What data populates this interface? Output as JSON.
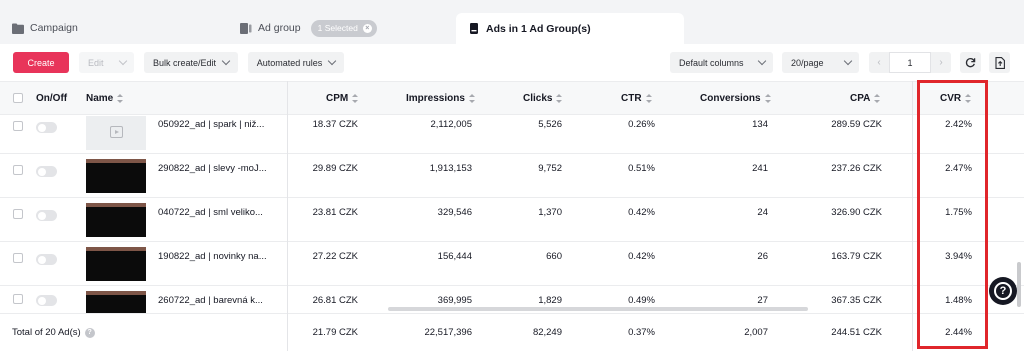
{
  "tabs": {
    "campaign": "Campaign",
    "ad_group": "Ad group",
    "selected_pill": "1 Selected",
    "ads": "Ads in 1 Ad Group(s)"
  },
  "toolbar": {
    "create": "Create",
    "edit": "Edit",
    "bulk": "Bulk create/Edit",
    "automated": "Automated rules",
    "default_columns": "Default columns",
    "per_page": "20/page",
    "page": "1"
  },
  "columns": {
    "on_off": "On/Off",
    "name": "Name",
    "cpm": "CPM",
    "impressions": "Impressions",
    "clicks": "Clicks",
    "ctr": "CTR",
    "conversions": "Conversions",
    "cpa": "CPA",
    "cvr": "CVR"
  },
  "rows": [
    {
      "name": "050922_ad | spark | niž...",
      "cpm": "18.37 CZK",
      "impressions": "2,112,005",
      "clicks": "5,526",
      "ctr": "0.26%",
      "conversions": "134",
      "cpa": "289.59 CZK",
      "cvr": "2.42%",
      "thumb": "placeholder"
    },
    {
      "name": "290822_ad | slevy -moJ...",
      "cpm": "29.89 CZK",
      "impressions": "1,913,153",
      "clicks": "9,752",
      "ctr": "0.51%",
      "conversions": "241",
      "cpa": "237.26 CZK",
      "cvr": "2.47%",
      "thumb": "image"
    },
    {
      "name": "040722_ad | sml veliko...",
      "cpm": "23.81 CZK",
      "impressions": "329,546",
      "clicks": "1,370",
      "ctr": "0.42%",
      "conversions": "24",
      "cpa": "326.90 CZK",
      "cvr": "1.75%",
      "thumb": "image"
    },
    {
      "name": "190822_ad | novinky na...",
      "cpm": "27.22 CZK",
      "impressions": "156,444",
      "clicks": "660",
      "ctr": "0.42%",
      "conversions": "26",
      "cpa": "163.79 CZK",
      "cvr": "3.94%",
      "thumb": "image"
    },
    {
      "name": "260722_ad | barevná k...",
      "cpm": "26.81 CZK",
      "impressions": "369,995",
      "clicks": "1,829",
      "ctr": "0.49%",
      "conversions": "27",
      "cpa": "367.35 CZK",
      "cvr": "1.48%",
      "thumb": "image"
    }
  ],
  "total": {
    "label": "Total of 20 Ad(s)",
    "cpm": "21.79 CZK",
    "impressions": "22,517,396",
    "clicks": "82,249",
    "ctr": "0.37%",
    "conversions": "2,007",
    "cpa": "244.51 CZK",
    "cvr": "2.44%"
  },
  "colors": {
    "accent": "#e8345a",
    "highlight": "#e0262b"
  }
}
